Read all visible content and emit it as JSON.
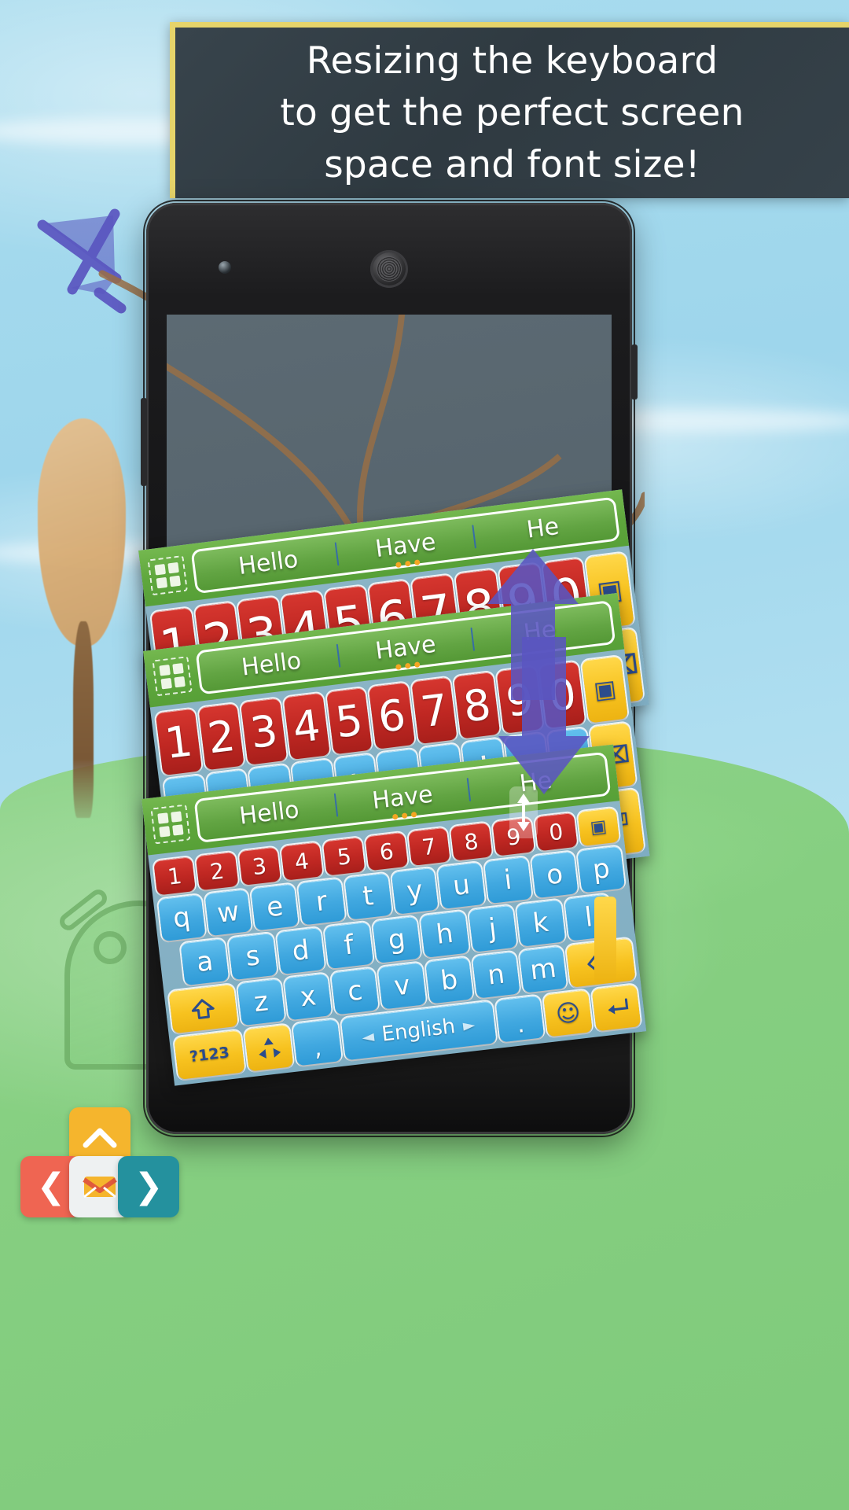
{
  "banner": {
    "lines": [
      "Resizing the keyboard",
      "to get the perfect screen",
      "space and font size!"
    ],
    "bg_color": "#36424a",
    "border_color": "#e6d46a",
    "text_color": "#ffffff"
  },
  "background": {
    "sky_color": "#a9dcee",
    "grass_color": "#86cf81",
    "plane_color": "#5a55c0",
    "tree_crown_color": "#d8ab72",
    "tree_trunk_color": "#7a5836",
    "android_mark_color": "#6aab62"
  },
  "device": {
    "name": "phone-mockup",
    "body_color": "#131314",
    "screen_color": "#57656e"
  },
  "keyboard": {
    "theme": {
      "suggestion_bar_color": "#5ea63c",
      "keyboard_bg_color": "#86b1c4",
      "number_key_color": "#bf2722",
      "letter_key_color": "#41a8e0",
      "function_key_color": "#f7c21f",
      "function_key_text_color": "#2b4c8c"
    },
    "suggestions": [
      "Hello",
      "Have",
      "He"
    ],
    "grid_icon": "apps-grid-icon",
    "rows": {
      "numbers": [
        "1",
        "2",
        "3",
        "4",
        "5",
        "6",
        "7",
        "8",
        "9",
        "0"
      ],
      "row1": [
        "q",
        "w",
        "e",
        "r",
        "t",
        "y",
        "u",
        "i",
        "o",
        "p"
      ],
      "row2": [
        "a",
        "s",
        "d",
        "f",
        "g",
        "h",
        "j",
        "k",
        "l"
      ],
      "row3": [
        "z",
        "x",
        "c",
        "v",
        "b",
        "n",
        "m"
      ]
    },
    "function_keys": {
      "shift": "shift-icon",
      "backspace": "backspace-icon",
      "symbols": "?123",
      "arrows": "arrow-keys-icon",
      "comma": ",",
      "space_label": "English",
      "space_prev": "◄",
      "space_next": "►",
      "period": ".",
      "emoji": "emoji-icon",
      "enter": "enter-icon",
      "box": "box-icon"
    }
  },
  "resize_gesture": {
    "up_arrow": "arrow-up-icon",
    "down_arrow": "arrow-down-icon",
    "vertical_handle": "resize-vertical-handle",
    "color": "#5a55c0"
  },
  "app_logo": {
    "name": "app-logo-badge",
    "top_tile_color": "#f5b52d",
    "left_tile_color": "#ef6552",
    "mid_tile_color": "#eef1f2",
    "right_tile_color": "#24919e",
    "left_glyph": "❮",
    "right_glyph": "❯",
    "top_glyph": "chevron-up-icon",
    "mid_glyph": "envelope-icon"
  }
}
